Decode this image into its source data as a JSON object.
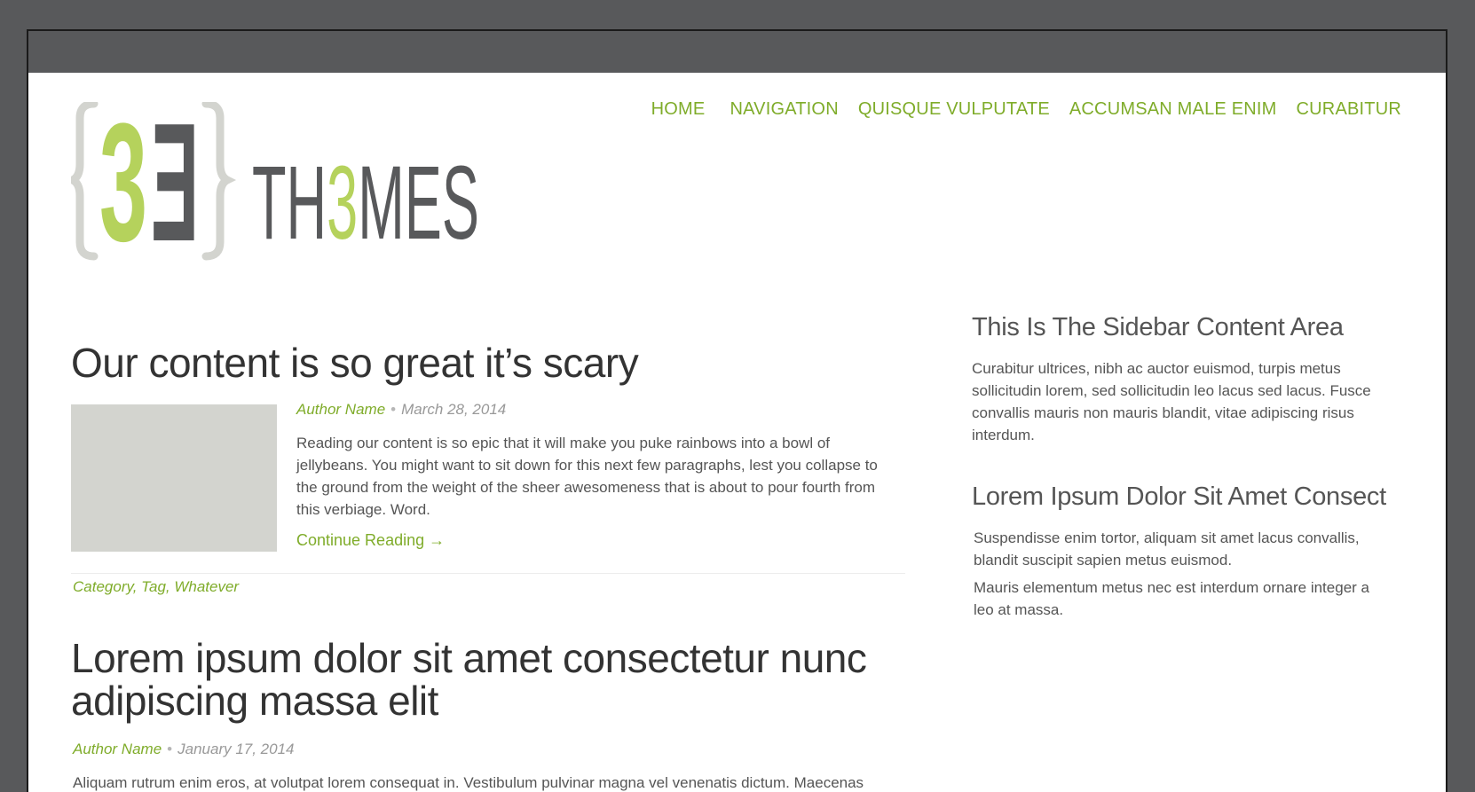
{
  "header": {
    "logo": {
      "mark_left": "3",
      "mark_right": "E",
      "wordmark_part1": "TH",
      "wordmark_accent": "3",
      "wordmark_part2": "MES",
      "colors": {
        "accent": "#b5d25c",
        "dark": "#58595b",
        "bracket": "#d3d4cf"
      }
    },
    "nav": [
      {
        "label": "HOME"
      },
      {
        "label": "NAVIGATION"
      },
      {
        "label": "QUISQUE VULPUTATE"
      },
      {
        "label": "ACCUMSAN MALE ENIM"
      },
      {
        "label": "CURABITUR"
      }
    ]
  },
  "posts": [
    {
      "title": "Our content is so great it’s scary",
      "author": "Author Name",
      "date": "March 28, 2014",
      "excerpt": "Reading our content is so epic that it will make you puke rainbows into a bowl of jellybeans. You might want to sit down for this next few paragraphs, lest you collapse to the ground from the weight of the sheer awesomeness that is about to pour fourth from this verbiage. Word.",
      "continue_label": "Continue Reading →",
      "tags": "Category, Tag, Whatever"
    },
    {
      "title": "Lorem ipsum dolor sit amet consectetur nunc adipiscing massa elit",
      "author": "Author Name",
      "date": "January 17, 2014",
      "excerpt": "Aliquam rutrum enim eros, at volutpat lorem consequat in. Vestibulum pulvinar magna vel venenatis dictum. Maecenas"
    }
  ],
  "meta_separator": "•",
  "sidebar": {
    "widgets": [
      {
        "title": "This Is The Sidebar Content Area",
        "text": "Curabitur ultrices, nibh ac auctor euismod, turpis metus sollicitudin lorem, sed sollicitudin leo lacus sed lacus. Fusce convallis mauris non mauris blandit, vitae adipiscing risus interdum."
      },
      {
        "title": "Lorem Ipsum Dolor Sit Amet Consect",
        "paragraphs": [
          "Suspendisse enim tortor, aliquam sit amet lacus convallis, blandit suscipit sapien metus euismod.",
          "Mauris elementum metus nec est interdum ornare integer a leo at massa."
        ]
      }
    ]
  },
  "colors": {
    "accent_green": "#7fac2a",
    "frame_gray": "#58595b",
    "text": "#555555",
    "thumbnail": "#d3d4cf"
  }
}
